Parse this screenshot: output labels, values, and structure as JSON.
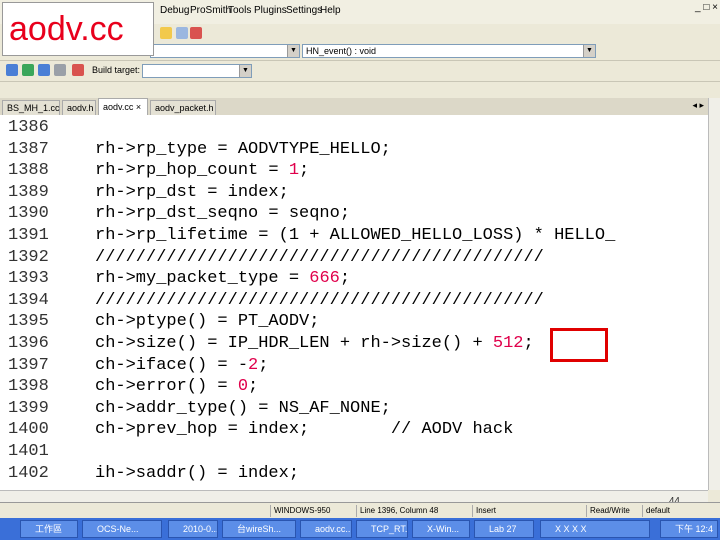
{
  "overlay_title": "aodv.cc",
  "menu": [
    "Debug",
    "ProSmith",
    "Tools",
    "Plugins",
    "Settings",
    "Help"
  ],
  "window_controls": "_ □ ×",
  "toolbar": {
    "scope_value": "",
    "function_value": "HN_event() : void",
    "build_target_label": "Build target:",
    "build_target_value": ""
  },
  "tabs": [
    {
      "label": "BS_MH_1.cc",
      "active": false
    },
    {
      "label": "aodv.h",
      "active": false
    },
    {
      "label": "aodv.cc",
      "active": true,
      "close": "×"
    },
    {
      "label": "aodv_packet.h",
      "active": false
    }
  ],
  "code_lines": [
    {
      "num": "1386",
      "code": ""
    },
    {
      "num": "1387",
      "code": "rh->rp_type = AODVTYPE_HELLO;"
    },
    {
      "num": "1388",
      "code": "rh->rp_hop_count = ",
      "num_val": "1",
      "tail": ";"
    },
    {
      "num": "1389",
      "code": "rh->rp_dst = index;"
    },
    {
      "num": "1390",
      "code": "rh->rp_dst_seqno = seqno;"
    },
    {
      "num": "1391",
      "code": "rh->rp_lifetime = (1 + ALLOWED_HELLO_LOSS) * HELLO_"
    },
    {
      "num": "1392",
      "code": "////////////////////////////////////////////"
    },
    {
      "num": "1393",
      "code": "rh->my_packet_type = ",
      "num_val": "666",
      "tail": ";"
    },
    {
      "num": "1394",
      "code": "////////////////////////////////////////////"
    },
    {
      "num": "1395",
      "code": "ch->ptype() = PT_AODV;"
    },
    {
      "num": "1396",
      "code": "ch->size() = IP_HDR_LEN + rh->size() + ",
      "num_val": "512",
      "tail": ";"
    },
    {
      "num": "1397",
      "code": "ch->iface() = -",
      "num_val": "2",
      "tail": ";"
    },
    {
      "num": "1398",
      "code": "ch->error() = ",
      "num_val": "0",
      "tail": ";"
    },
    {
      "num": "1399",
      "code": "ch->addr_type() = NS_AF_NONE;"
    },
    {
      "num": "1400",
      "code": "ch->prev_hop = index;        // AODV hack"
    },
    {
      "num": "1401",
      "code": ""
    },
    {
      "num": "1402",
      "code": "ih->saddr() = index;"
    }
  ],
  "status": {
    "encoding": "WINDOWS-950",
    "position": "Line 1396, Column 48",
    "mode": "Insert",
    "rw": "Read/Write",
    "profile": "default"
  },
  "page_number": "44",
  "taskbar": [
    {
      "label": "工作區"
    },
    {
      "label": "OCS-Ne..."
    },
    {
      "label": "2010-0..."
    },
    {
      "label": "台wireSh..."
    },
    {
      "label": "aodv.cc..."
    },
    {
      "label": "TCP_RT..."
    },
    {
      "label": "X-Win..."
    },
    {
      "label": "Lab 27"
    },
    {
      "label": "X X X X"
    },
    {
      "label": "下午 12:4"
    }
  ],
  "colors": {
    "number_literal": "#e0004b",
    "highlight_box": "#e00000",
    "overlay_title": "#e8001c"
  }
}
